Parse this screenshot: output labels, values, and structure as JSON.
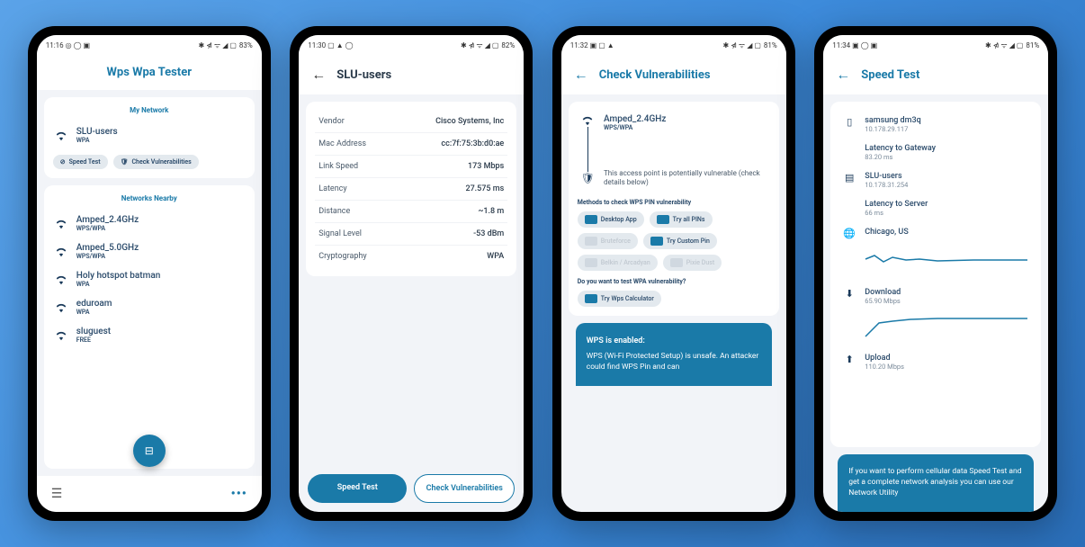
{
  "screens": {
    "main": {
      "status": {
        "time": "11:16",
        "icons": "◎ ◯ ▣",
        "battery": "83%",
        "signals": "✱ ⋪ ᯤ ◢ ▢"
      },
      "title": "Wps Wpa Tester",
      "my_network_label": "My Network",
      "my_network": {
        "name": "SLU-users",
        "security": "WPA"
      },
      "speed_test_btn": "Speed Test",
      "check_vuln_btn": "Check Vulnerabilities",
      "nearby_label": "Networks Nearby",
      "networks": [
        {
          "name": "Amped_2.4GHz",
          "security": "WPS/WPA"
        },
        {
          "name": "Amped_5.0GHz",
          "security": "WPS/WPA"
        },
        {
          "name": "Holy hotspot batman",
          "security": "WPA"
        },
        {
          "name": "eduroam",
          "security": "WPA"
        },
        {
          "name": "sluguest",
          "security": "FREE"
        }
      ]
    },
    "detail": {
      "status": {
        "time": "11:30",
        "icons": "▢ ▲ ◯",
        "battery": "82%",
        "signals": "✱ ⋪ ᯤ ◢ ▢"
      },
      "title": "SLU-users",
      "rows": [
        {
          "label": "Vendor",
          "value": "Cisco Systems, Inc"
        },
        {
          "label": "Mac Address",
          "value": "cc:7f:75:3b:d0:ae"
        },
        {
          "label": "Link Speed",
          "value": "173 Mbps"
        },
        {
          "label": "Latency",
          "value": "27.575 ms"
        },
        {
          "label": "Distance",
          "value": "~1.8 m"
        },
        {
          "label": "Signal Level",
          "value": "-53 dBm"
        },
        {
          "label": "Cryptography",
          "value": "WPA"
        }
      ],
      "speed_test_btn": "Speed Test",
      "check_vuln_btn": "Check Vulnerabilities"
    },
    "vuln": {
      "status": {
        "time": "11:32",
        "icons": "▣ ▢ ▲",
        "battery": "81%",
        "signals": "✱ ⋪ ᯤ ◢ ▢"
      },
      "title": "Check Vulnerabilities",
      "network": {
        "name": "Amped_2.4GHz",
        "security": "WPS/WPA"
      },
      "warning": "This access point is potentially vulnerable (check details below)",
      "methods_label": "Methods to check WPS PIN vulnerability",
      "methods": [
        {
          "label": "Desktop App",
          "enabled": true
        },
        {
          "label": "Try all PINs",
          "enabled": true
        },
        {
          "label": "Bruteforce",
          "enabled": false
        },
        {
          "label": "Try Custom Pin",
          "enabled": true
        },
        {
          "label": "Belkin / Arcadyan",
          "enabled": false
        },
        {
          "label": "Pixie Dust",
          "enabled": false
        }
      ],
      "wpa_question": "Do you want to test WPA vulnerability?",
      "wpa_calc_btn": "Try Wps Calculator",
      "banner_title": "WPS is enabled:",
      "banner_text": "WPS (Wi-Fi Protected Setup) is unsafe. An attacker could find WPS Pin and can"
    },
    "speed": {
      "status": {
        "time": "11:34",
        "icons": "▣ ◯ ▣",
        "battery": "81%",
        "signals": "✱ ⋪ ᯤ ◢ ▢"
      },
      "title": "Speed Test",
      "device": {
        "name": "samsung dm3q",
        "ip": "10.178.29.117"
      },
      "gateway_label": "Latency to Gateway",
      "gateway_val": "83.20 ms",
      "router": {
        "name": "SLU-users",
        "ip": "10.178.31.254"
      },
      "server_label": "Latency to Server",
      "server_val": "66 ms",
      "location": "Chicago, US",
      "download_label": "Download",
      "download_val": "65.90 Mbps",
      "upload_label": "Upload",
      "upload_val": "110.20 Mbps",
      "banner_text": "If you want to perform cellular data Speed Test and get a complete network analysis you can use our Network Utility"
    }
  }
}
